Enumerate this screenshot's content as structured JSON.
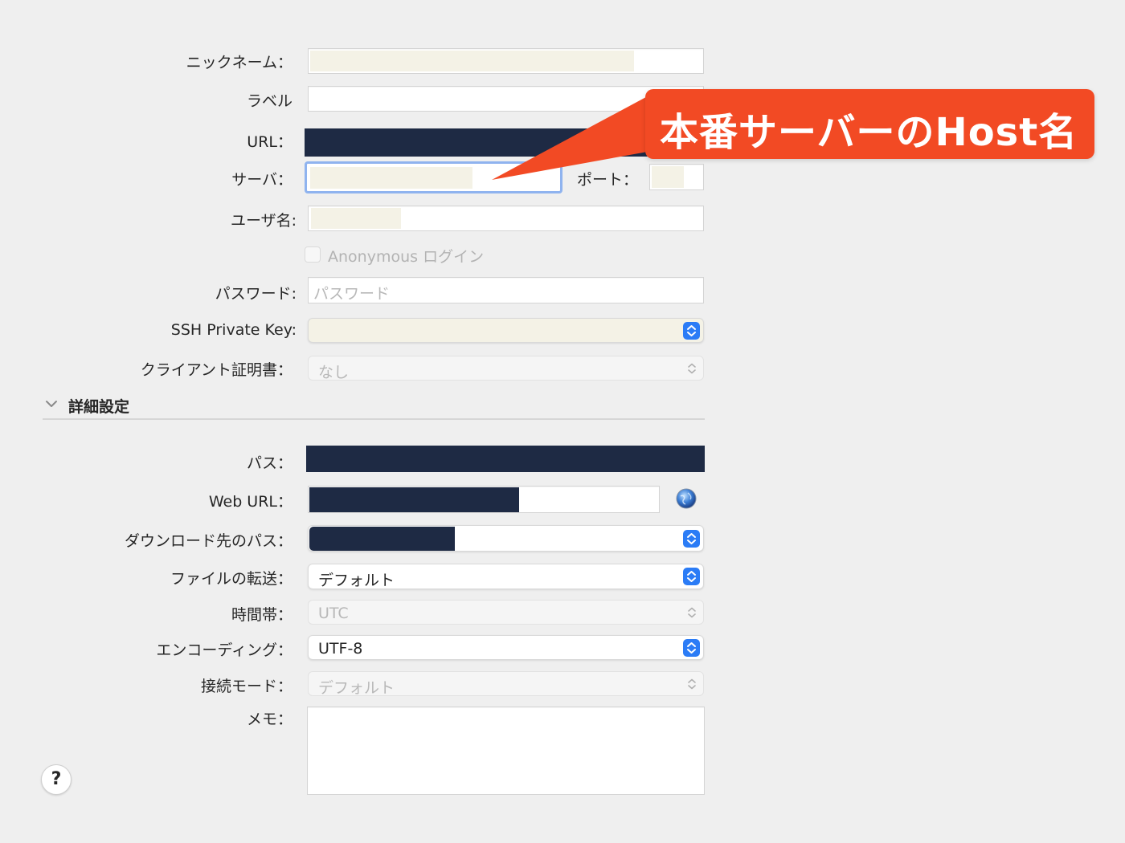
{
  "fields": {
    "nickname_label": "ニックネーム：",
    "label_label": "ラベル",
    "url_label": "URL：",
    "server_label": "サーバ：",
    "port_label": "ポート：",
    "username_label": "ユーザ名:",
    "anonymous_label": "Anonymous ログイン",
    "password_label": "パスワード:",
    "password_placeholder": "パスワード",
    "ssh_key_label": "SSH Private Key:",
    "client_cert_label": "クライアント証明書：",
    "client_cert_value": "なし"
  },
  "advanced": {
    "section_title": "詳細設定",
    "path_label": "パス：",
    "web_url_label": "Web URL：",
    "download_path_label": "ダウンロード先のパス：",
    "transfer_label": "ファイルの転送：",
    "transfer_value": "デフォルト",
    "timezone_label": "時間帯：",
    "timezone_value": "UTC",
    "encoding_label": "エンコーディング：",
    "encoding_value": "UTF-8",
    "connect_mode_label": "接続モード：",
    "connect_mode_value": "デフォルト",
    "memo_label": "メモ："
  },
  "help_label": "?",
  "callout": {
    "text": "本番サーバーのHost名",
    "color": "#f24a24"
  },
  "colors": {
    "redaction_navy": "#1e2a44",
    "autofill_cream": "#f4f2e6",
    "accent_blue": "#2b7cf6",
    "focus_ring": "#8fb3ef"
  },
  "icons": [
    "globe-icon",
    "chevron-down-icon",
    "updown-stepper-icon",
    "callout-arrow"
  ]
}
